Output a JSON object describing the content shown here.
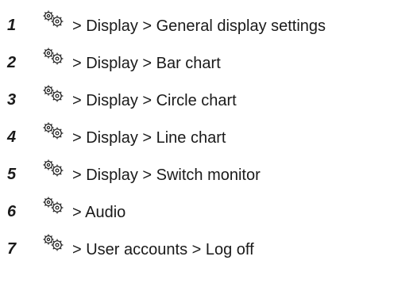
{
  "steps": [
    {
      "number": "1",
      "icon": "gears-icon",
      "path": "> Display > General display settings"
    },
    {
      "number": "2",
      "icon": "gears-icon",
      "path": "> Display > Bar chart"
    },
    {
      "number": "3",
      "icon": "gears-icon",
      "path": "> Display > Circle chart"
    },
    {
      "number": "4",
      "icon": "gears-icon",
      "path": "> Display > Line chart"
    },
    {
      "number": "5",
      "icon": "gears-icon",
      "path": "> Display > Switch monitor"
    },
    {
      "number": "6",
      "icon": "gears-icon",
      "path": "> Audio"
    },
    {
      "number": "7",
      "icon": "gears-icon",
      "path": "> User accounts > Log off"
    }
  ]
}
